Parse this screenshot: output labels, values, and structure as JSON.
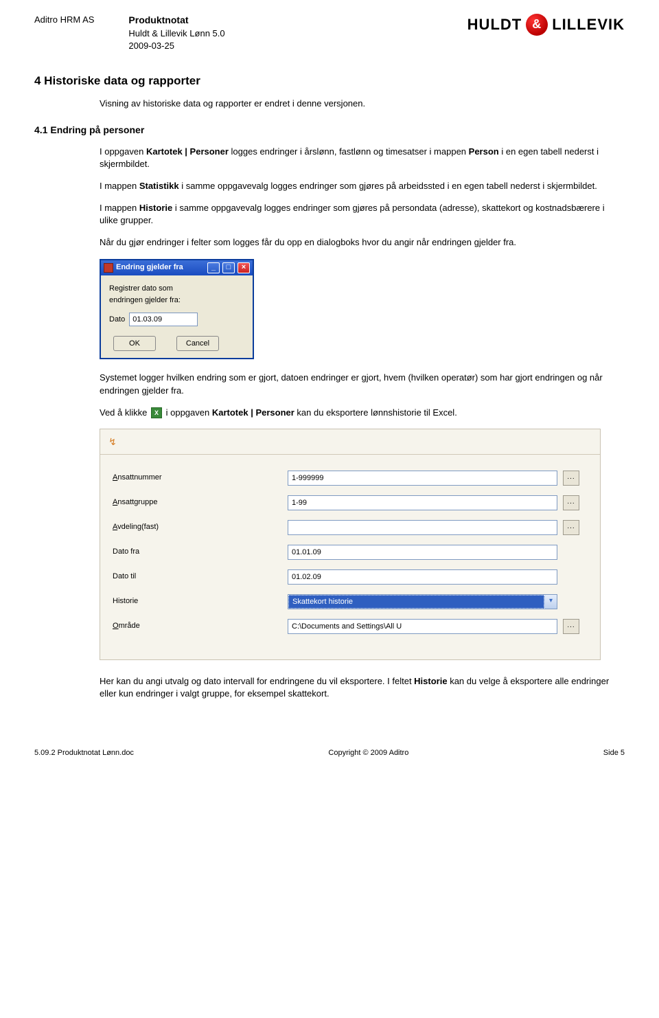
{
  "header": {
    "company": "Aditro HRM AS",
    "product_title": "Produktnotat",
    "product_name": "Huldt & Lillevik Lønn 5.0",
    "date": "2009-03-25",
    "logo_left": "HULDT",
    "logo_amp": "&",
    "logo_right": "LILLEVIK"
  },
  "section4": {
    "heading": "4 Historiske data og rapporter",
    "intro": "Visning av historiske data og rapporter er endret i denne versjonen."
  },
  "section41": {
    "heading": "4.1 Endring på personer",
    "p1a": "I oppgaven ",
    "p1b": "Kartotek | Personer",
    "p1c": " logges endringer i årslønn, fastlønn og timesatser i mappen ",
    "p1d": "Person",
    "p1e": " i en egen tabell nederst i skjermbildet.",
    "p2a": "I mappen ",
    "p2b": "Statistikk",
    "p2c": " i samme oppgavevalg logges endringer som gjøres på arbeidssted i en egen tabell nederst i skjermbildet.",
    "p3a": "I mappen ",
    "p3b": "Historie",
    "p3c": " i samme oppgavevalg logges endringer som gjøres på persondata (adresse), skattekort og kostnadsbærere i ulike grupper.",
    "p4": "Når du gjør endringer i felter som logges får du opp en dialogboks hvor du angir når endringen gjelder fra.",
    "p5": "Systemet logger hvilken endring som er gjort, datoen endringer er gjort, hvem (hvilken operatør) som har gjort endringen og når endringen gjelder fra.",
    "p6a": "Ved å klikke ",
    "p6b": " i oppgaven ",
    "p6c": "Kartotek | Personer",
    "p6d": " kan du eksportere lønnshistorie til Excel.",
    "p7a": "Her kan du angi utvalg og dato intervall for endringene du vil eksportere. I feltet ",
    "p7b": "Historie",
    "p7c": " kan du velge å eksportere alle endringer eller kun endringer i valgt gruppe, for eksempel skattekort."
  },
  "dialog": {
    "title": "Endring gjelder fra",
    "line1": "Registrer dato som",
    "line2": "endringen gjelder fra:",
    "date_label": "Dato",
    "date_value": "01.03.09",
    "ok": "OK",
    "cancel": "Cancel"
  },
  "excel_icon_text": "X",
  "form": {
    "fields": [
      {
        "label_pre": "A",
        "label_post": "nsattnummer",
        "value": "1-999999",
        "browse": true
      },
      {
        "label_pre": "A",
        "label_post": "nsattgruppe",
        "value": "1-99",
        "browse": true
      },
      {
        "label_pre": "A",
        "label_post": "vdeling(fast)",
        "value": "",
        "browse": true
      },
      {
        "label_pre": "",
        "label_post": "Dato fra",
        "value": "01.01.09",
        "browse": false
      },
      {
        "label_pre": "",
        "label_post": "Dato til",
        "value": "01.02.09",
        "browse": false
      },
      {
        "label_pre": "",
        "label_post": "Historie",
        "value": "Skattekort historie",
        "select": true
      },
      {
        "label_pre": "O",
        "label_post": "mråde",
        "value": "C:\\Documents and Settings\\All U",
        "browse": true
      }
    ],
    "browse_text": "..."
  },
  "footer": {
    "left": "5.09.2 Produktnotat Lønn.doc",
    "center": "Copyright © 2009 Aditro",
    "right": "Side 5"
  }
}
